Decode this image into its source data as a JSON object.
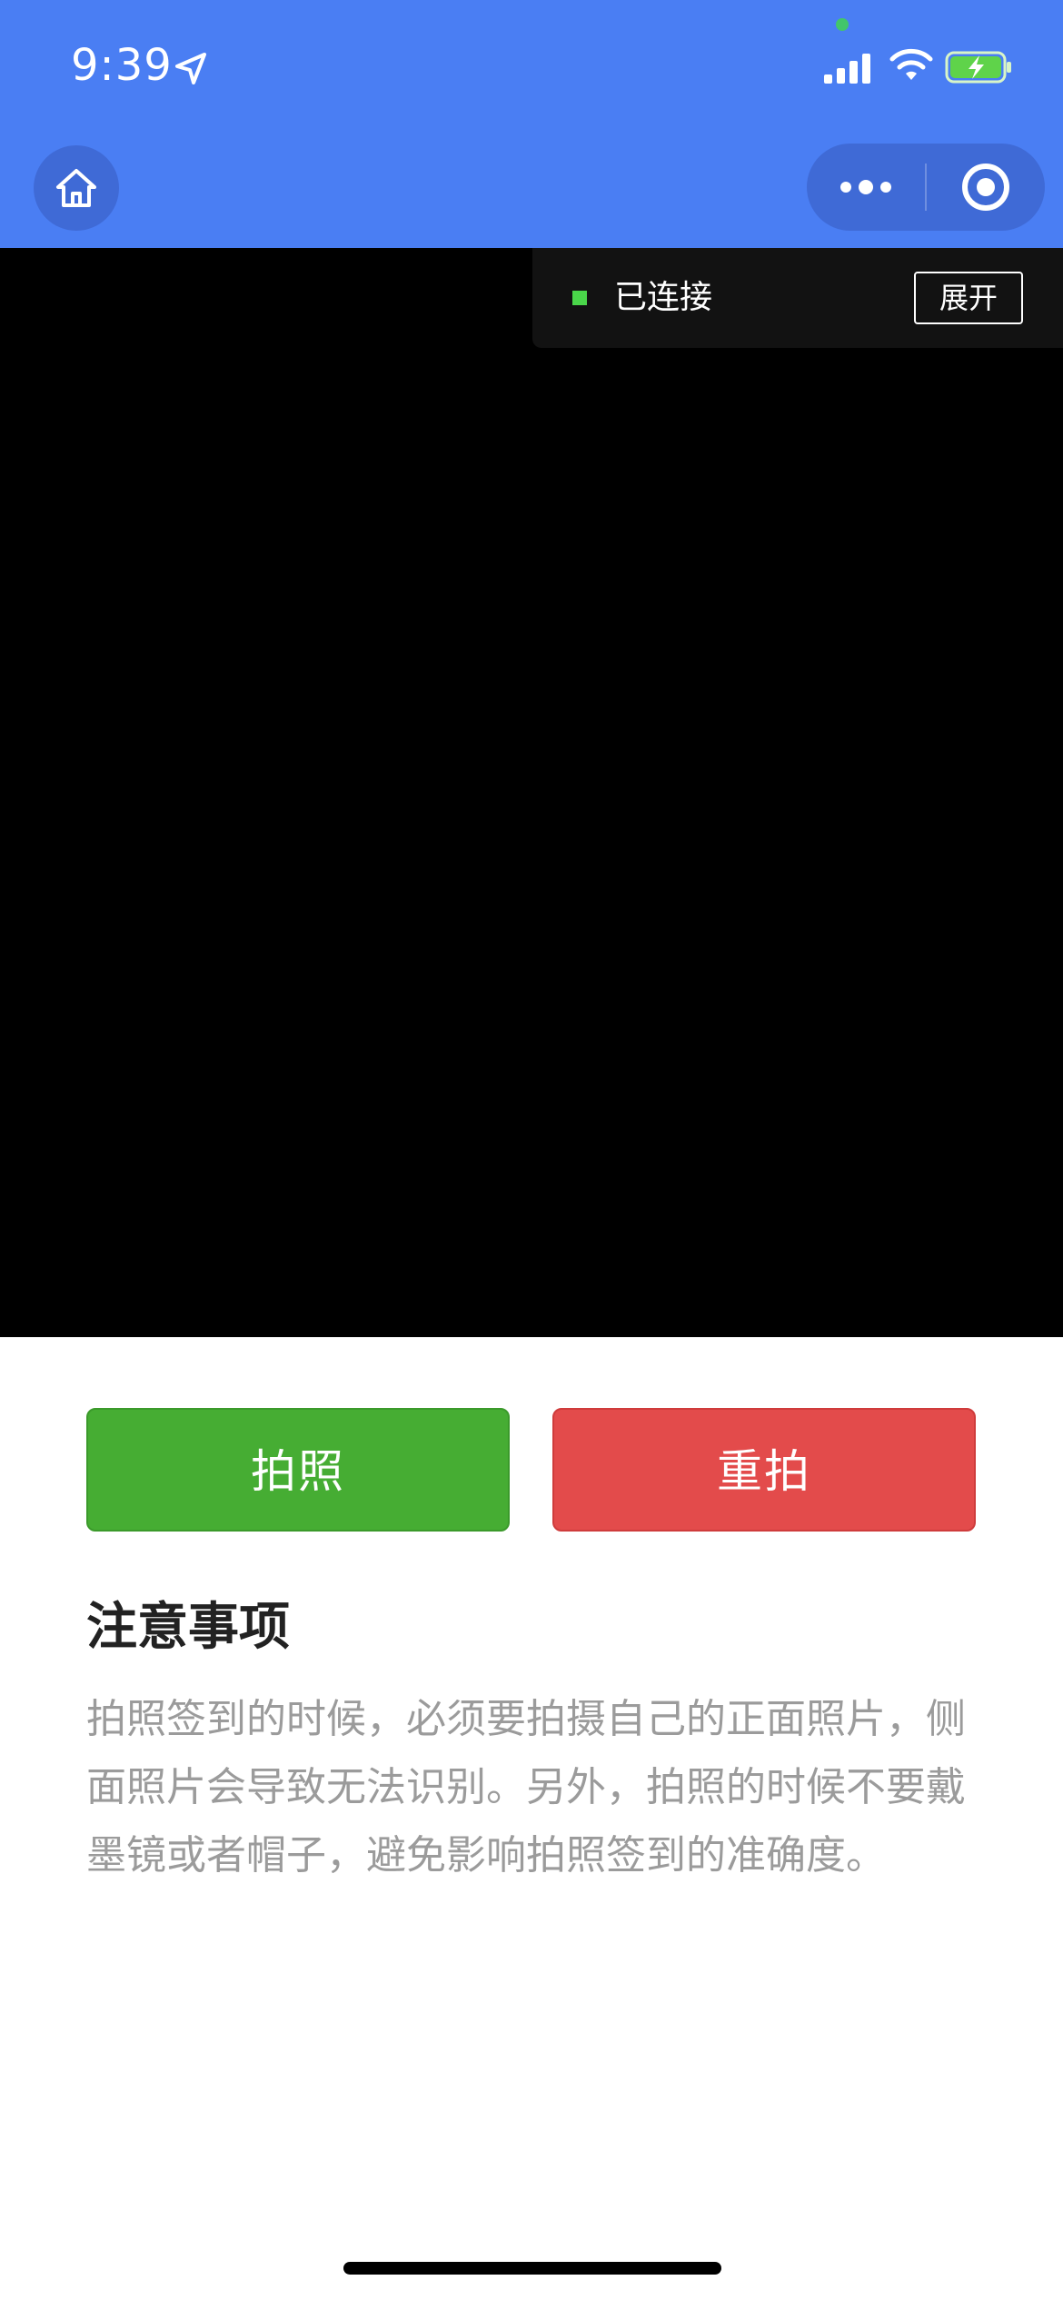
{
  "status_bar": {
    "time": "9:39",
    "icons": [
      "location-arrow-icon",
      "signal-icon",
      "wifi-icon",
      "battery-charging-icon"
    ]
  },
  "nav_bar": {
    "home_icon": "home-icon",
    "more_icon": "more-dots-icon",
    "close_icon": "target-close-icon"
  },
  "connection": {
    "status_label": "已连接",
    "expand_label": "展开",
    "status_color": "#4ad64a"
  },
  "actions": {
    "photo_label": "拍照",
    "retake_label": "重拍",
    "photo_color": "#46ad33",
    "retake_color": "#e34b4b"
  },
  "notes": {
    "title": "注意事项",
    "body": "拍照签到的时候，必须要拍摄自己的正面照片，侧面照片会导致无法识别。另外，拍照的时候不要戴墨镜或者帽子，避免影响拍照签到的准确度。"
  },
  "theme": {
    "header_color": "#4a7ef3"
  }
}
